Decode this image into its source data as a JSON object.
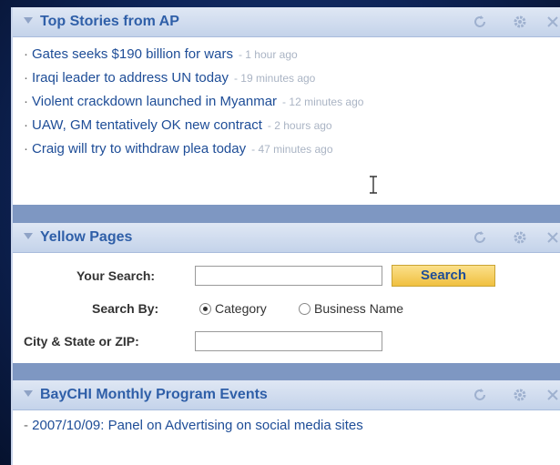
{
  "ap": {
    "title": "Top Stories from AP",
    "stories": [
      {
        "headline": "Gates seeks $190 billion for wars",
        "age": "1 hour ago"
      },
      {
        "headline": "Iraqi leader to address UN today",
        "age": "19 minutes ago"
      },
      {
        "headline": "Violent crackdown launched in Myanmar",
        "age": "12 minutes ago"
      },
      {
        "headline": "UAW, GM tentatively OK new contract",
        "age": "2 hours ago"
      },
      {
        "headline": "Craig will try to withdraw plea today",
        "age": "47 minutes ago"
      }
    ]
  },
  "yp": {
    "title": "Yellow Pages",
    "search_label": "Your Search:",
    "search_value": "",
    "search_button": "Search",
    "search_by_label": "Search By:",
    "option_category": "Category",
    "option_business": "Business Name",
    "selected_option": "Category",
    "location_label": "City & State or ZIP:",
    "location_value": ""
  },
  "baychi": {
    "title": "BayCHI Monthly Program Events",
    "events": [
      "2007/10/09: Panel on Advertising on social media sites"
    ]
  },
  "colors": {
    "title_blue": "#2f5fa8",
    "link_blue": "#1e4d97",
    "age_gray": "#aab4c4",
    "button_yellow": "#f0c040"
  },
  "icons": {
    "collapse": "collapse-arrow-icon",
    "refresh": "refresh-icon",
    "settings": "gear-icon",
    "close": "close-icon",
    "cursor": "text-cursor-icon"
  }
}
